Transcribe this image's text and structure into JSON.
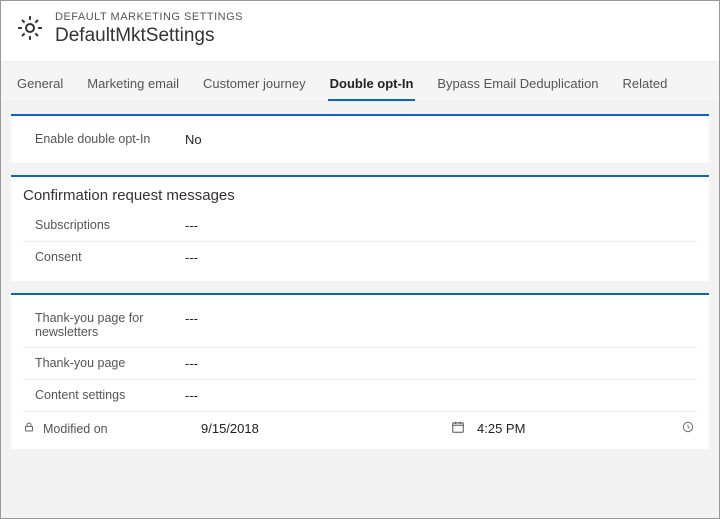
{
  "header": {
    "subtitle": "DEFAULT MARKETING SETTINGS",
    "title": "DefaultMktSettings"
  },
  "tabs": [
    {
      "label": "General"
    },
    {
      "label": "Marketing email"
    },
    {
      "label": "Customer journey"
    },
    {
      "label": "Double opt-In"
    },
    {
      "label": "Bypass Email Deduplication"
    },
    {
      "label": "Related"
    }
  ],
  "section1": {
    "enable_label": "Enable double opt-In",
    "enable_value": "No"
  },
  "section2": {
    "title": "Confirmation request messages",
    "subs_label": "Subscriptions",
    "subs_value": "---",
    "consent_label": "Consent",
    "consent_value": "---"
  },
  "section3": {
    "ty_news_label": "Thank-you page for newsletters",
    "ty_news_value": "---",
    "ty_page_label": "Thank-you page",
    "ty_page_value": "---",
    "content_label": "Content settings",
    "content_value": "---",
    "modified_label": "Modified on",
    "modified_date": "9/15/2018",
    "modified_time": "4:25 PM"
  }
}
